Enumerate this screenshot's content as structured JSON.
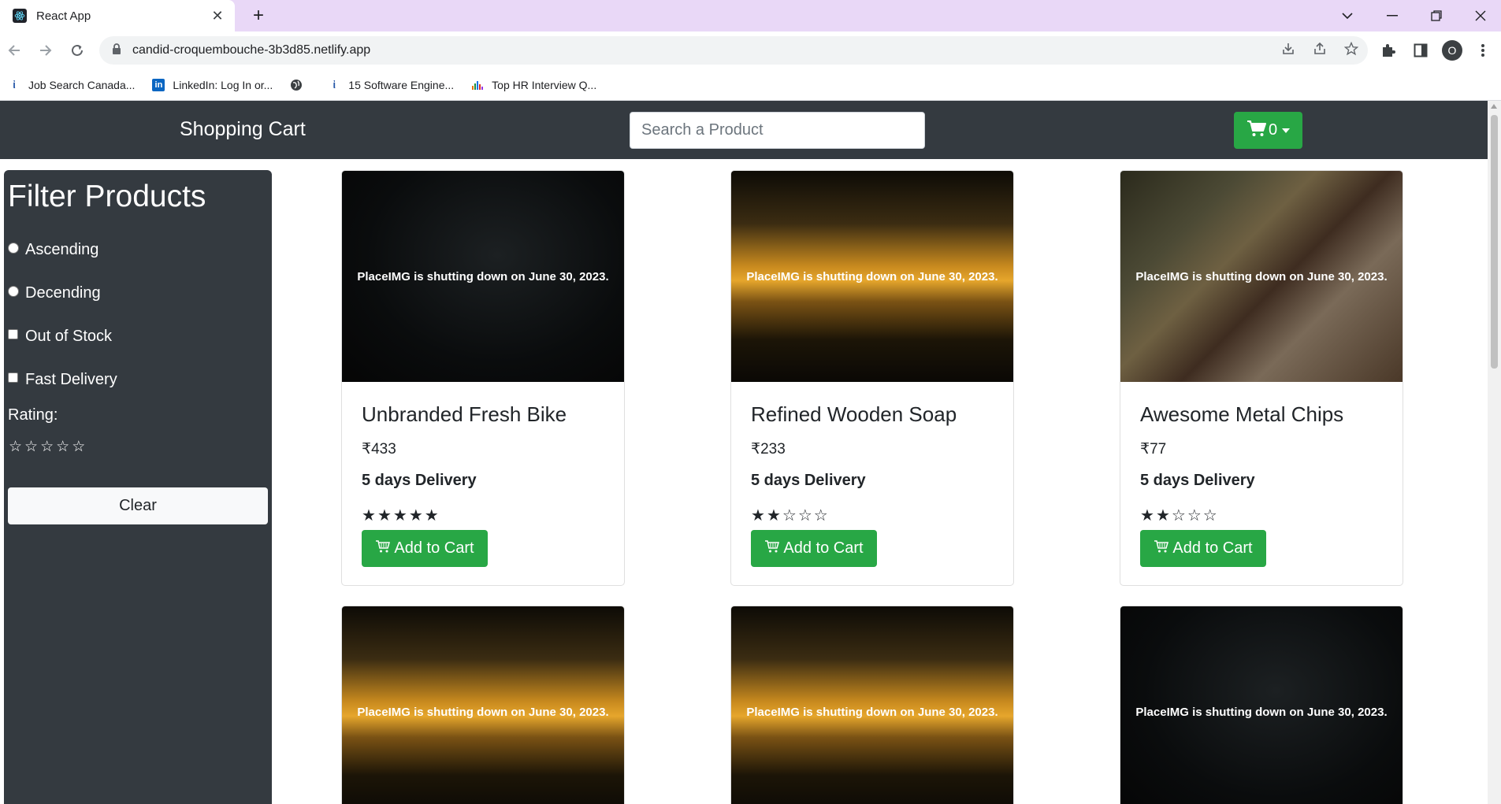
{
  "browser": {
    "tab_title": "React App",
    "url": "candid-croquembouche-3b3d85.netlify.app",
    "profile_initial": "O",
    "bookmarks": [
      {
        "label": "Job Search Canada...",
        "icon": "indeed-icon"
      },
      {
        "label": "LinkedIn: Log In or...",
        "icon": "linkedin-icon"
      },
      {
        "label": "",
        "icon": "globe-icon"
      },
      {
        "label": "15 Software Engine...",
        "icon": "indeed-icon"
      },
      {
        "label": "Top HR Interview Q...",
        "icon": "chart-icon"
      }
    ]
  },
  "navbar": {
    "brand": "Shopping Cart",
    "search_placeholder": "Search a Product",
    "cart_count": "0"
  },
  "filters": {
    "title": "Filter Products",
    "ascending": "Ascending",
    "descending": "Decending",
    "out_of_stock": "Out of Stock",
    "fast_delivery": "Fast Delivery",
    "rating_label": "Rating:",
    "rating_value": 0,
    "clear": "Clear"
  },
  "products": [
    {
      "name": "Unbranded Fresh Bike",
      "price": "₹433",
      "delivery": "5 days Delivery",
      "rating": 5,
      "image_text": "PlaceIMG is shutting down on June 30, 2023.",
      "button": "Add to Cart"
    },
    {
      "name": "Refined Wooden Soap",
      "price": "₹233",
      "delivery": "5 days Delivery",
      "rating": 2,
      "image_text": "PlaceIMG is shutting down on June 30, 2023.",
      "button": "Add to Cart"
    },
    {
      "name": "Awesome Metal Chips",
      "price": "₹77",
      "delivery": "5 days Delivery",
      "rating": 2,
      "image_text": "PlaceIMG is shutting down on June 30, 2023.",
      "button": "Add to Cart"
    },
    {
      "image_text": "PlaceIMG is shutting down on June 30, 2023."
    },
    {
      "image_text": "PlaceIMG is shutting down on June 30, 2023."
    },
    {
      "image_text": "PlaceIMG is shutting down on June 30, 2023."
    }
  ],
  "colors": {
    "navbar": "#343a40",
    "success": "#28a745",
    "tabbar": "#e9d8f7"
  }
}
